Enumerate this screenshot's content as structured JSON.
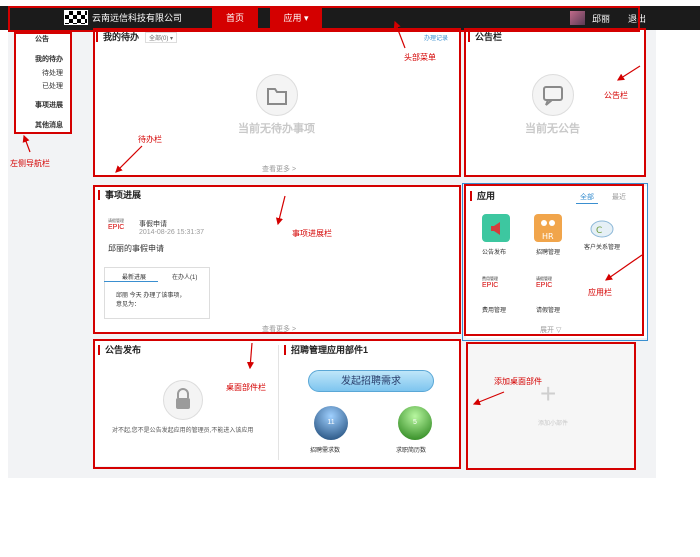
{
  "header": {
    "company": "云南远信科技有限公司",
    "nav": [
      "首页",
      "应用 ▾"
    ],
    "username": "邱丽",
    "logout": "退出"
  },
  "leftnav": {
    "items": [
      "公告",
      "我的待办",
      "待处理",
      "已处理",
      "事项进展",
      "其他消息"
    ]
  },
  "todo": {
    "title": "我的待办",
    "filter": "全部(0) ▾",
    "link": "办理记录",
    "empty": "当前无待办事项",
    "more": "查看更多 >"
  },
  "notice": {
    "title": "公告栏",
    "empty": "当前无公告"
  },
  "progress": {
    "title": "事项进展",
    "epic": "EPIC",
    "item_type": "事假申请",
    "item_time": "2014-08-26 15:31:37",
    "item_title": "邱丽的事假申请",
    "tabs": [
      "最新进展",
      "在办人(1)"
    ],
    "detail_line1": "邱丽 今天 办理了该事项，",
    "detail_line2": "意见为：",
    "more": "查看更多 >"
  },
  "apps": {
    "title": "应用",
    "tabs": [
      "全部",
      "最近"
    ],
    "items": [
      "公告发布",
      "招聘管理",
      "客户关系管理",
      "费用管理",
      "请假管理"
    ],
    "expand": "展开 ▽"
  },
  "publish": {
    "title": "公告发布",
    "text": "对不起,您不是公告发起应用的管理员,不能进入该应用"
  },
  "recruit": {
    "title": "招聘管理应用部件1",
    "button": "发起招聘需求",
    "count1": "11",
    "label1": "招聘需求数",
    "count2": "5",
    "label2": "求职简历数"
  },
  "addwidget": {
    "label": "添加小部件"
  },
  "annotations": {
    "header_menu": "头部菜单",
    "notice_bar": "公告栏",
    "todo_bar": "待办栏",
    "left_nav": "左侧导航栏",
    "progress_bar": "事项进展栏",
    "app_bar": "应用栏",
    "desktop_widget": "桌面部件栏",
    "add_widget": "添加桌面部件"
  }
}
